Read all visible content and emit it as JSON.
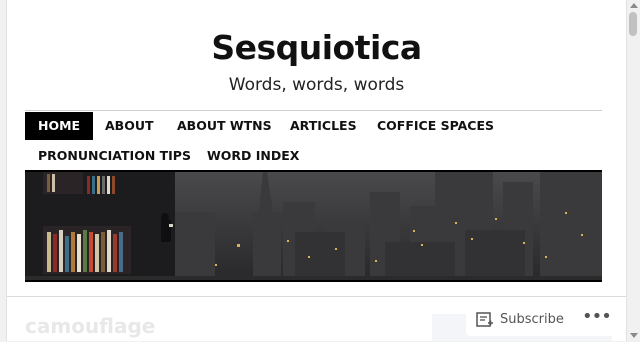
{
  "site": {
    "title": "Sesquiotica",
    "tagline": "Words, words, words"
  },
  "nav": {
    "items": [
      {
        "label": "HOME",
        "active": true
      },
      {
        "label": "ABOUT"
      },
      {
        "label": "ABOUT WTNS"
      },
      {
        "label": "ARTICLES"
      },
      {
        "label": "COFFICE SPACES"
      },
      {
        "label": "PRONUNCIATION TIPS"
      },
      {
        "label": "WORD INDEX"
      }
    ]
  },
  "banner": {
    "alt": ""
  },
  "post": {
    "title": "camouflage"
  },
  "subscribe": {
    "label": "Subscribe",
    "icon": "subscribe-icon",
    "more_icon": "more-icon"
  },
  "colors": {
    "nav_active_bg": "#000000",
    "nav_active_text": "#ffffff",
    "text": "#111111"
  }
}
